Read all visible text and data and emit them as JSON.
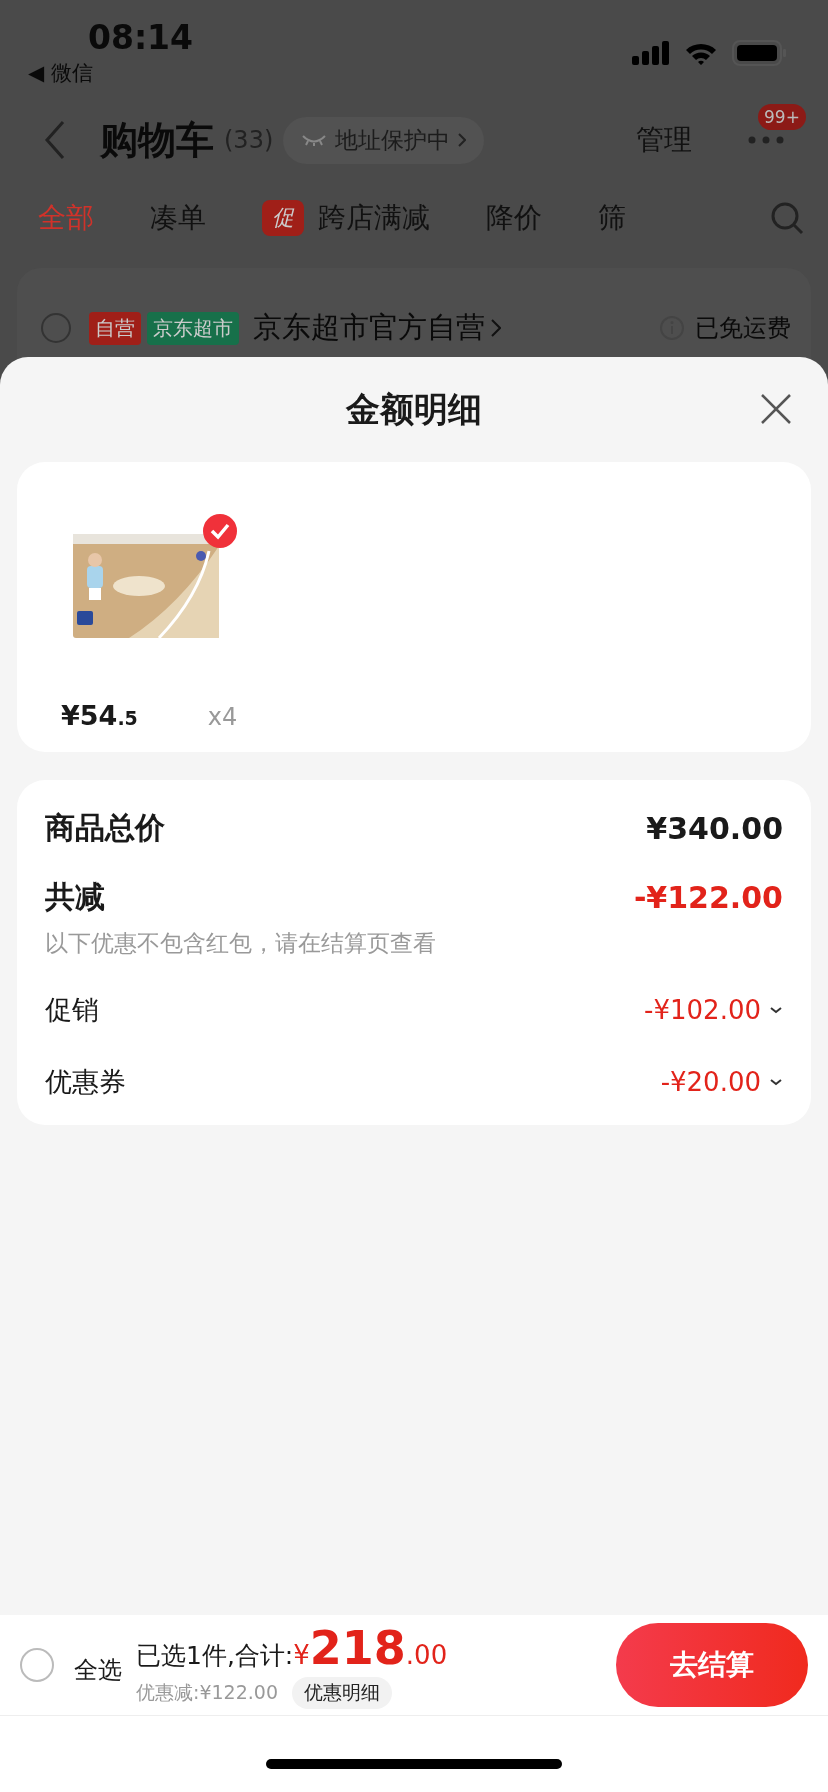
{
  "status_bar": {
    "time": "08:14",
    "back_label": "◀ 微信"
  },
  "header": {
    "title": "购物车",
    "count": "(33)",
    "address_badge": "地址保护中",
    "manage": "管理",
    "more_badge": "99+"
  },
  "tabs": [
    {
      "label": "全部",
      "selected": true
    },
    {
      "label": "凑单",
      "selected": false
    },
    {
      "label": "跨店满减",
      "selected": false,
      "tag": "促"
    },
    {
      "label": "降价",
      "selected": false
    },
    {
      "label": "筛",
      "selected": false
    }
  ],
  "store": {
    "checked": false,
    "tags": [
      {
        "text": "自营",
        "color": "#a01f18"
      },
      {
        "text": "京东超市",
        "color": "#17704a"
      }
    ],
    "name": "京东超市官方自营",
    "shipping": "已免运费"
  },
  "sheet": {
    "title": "金额明细",
    "product": {
      "checked": true,
      "price_main": "¥54",
      "price_decimal": ".5",
      "quantity": "x4"
    },
    "total": {
      "label": "商品总价",
      "value": "¥340.00"
    },
    "reduction": {
      "label": "共减",
      "value": "-¥122.00",
      "note": "以下优惠不包含红包，请在结算页查看"
    },
    "details": [
      {
        "label": "促销",
        "value": "-¥102.00"
      },
      {
        "label": "优惠券",
        "value": "-¥20.00"
      }
    ]
  },
  "bottom_bar": {
    "select_all": {
      "label": "全选",
      "checked": false
    },
    "summary": "已选1件,合计:",
    "currency": "¥",
    "amount": "218",
    "decimals": ".00",
    "discount": "优惠减:¥122.00",
    "detail_button": "优惠明细",
    "checkout": "去结算"
  }
}
